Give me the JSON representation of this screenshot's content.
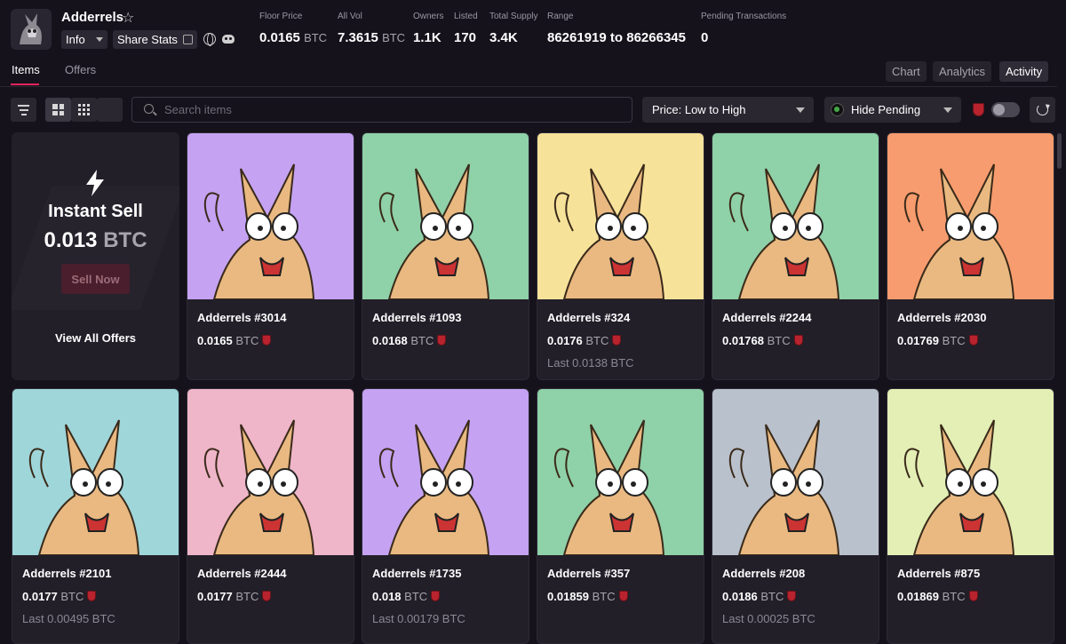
{
  "collection": {
    "name": "Adderrels",
    "info_label": "Info",
    "share_label": "Share Stats"
  },
  "stats": [
    {
      "label": "Floor Price",
      "value": "0.0165",
      "unit": "BTC"
    },
    {
      "label": "All Vol",
      "value": "7.3615",
      "unit": "BTC"
    },
    {
      "label": "Owners",
      "value": "1.1K",
      "unit": ""
    },
    {
      "label": "Listed",
      "value": "170",
      "unit": ""
    },
    {
      "label": "Total Supply",
      "value": "3.4K",
      "unit": ""
    },
    {
      "label": "Range",
      "value": "86261919 to 86266345",
      "unit": ""
    },
    {
      "label": "Pending Transactions",
      "value": "0",
      "unit": ""
    }
  ],
  "tabs": {
    "items": "Items",
    "offers": "Offers"
  },
  "view_tabs": [
    "Chart",
    "Analytics",
    "Activity"
  ],
  "toolbar": {
    "search_placeholder": "Search items",
    "sort_label": "Price: Low to High",
    "pending_label": "Hide Pending"
  },
  "instant_sell": {
    "title": "Instant Sell",
    "price": "0.013",
    "unit": "BTC",
    "button": "Sell Now",
    "view_all": "View All Offers"
  },
  "items": [
    {
      "name": "Adderrels #3014",
      "price": "0.0165",
      "unit": "BTC",
      "last": "",
      "bg": "#c5a2f2"
    },
    {
      "name": "Adderrels #1093",
      "price": "0.0168",
      "unit": "BTC",
      "last": "",
      "bg": "#8fd1a8"
    },
    {
      "name": "Adderrels #324",
      "price": "0.0176",
      "unit": "BTC",
      "last": "Last 0.0138 BTC",
      "bg": "#f7e29a"
    },
    {
      "name": "Adderrels #2244",
      "price": "0.01768",
      "unit": "BTC",
      "last": "",
      "bg": "#8fd1a8"
    },
    {
      "name": "Adderrels #2030",
      "price": "0.01769",
      "unit": "BTC",
      "last": "",
      "bg": "#f79c6e"
    },
    {
      "name": "Adderrels #2101",
      "price": "0.0177",
      "unit": "BTC",
      "last": "Last 0.00495 BTC",
      "bg": "#9fd6da"
    },
    {
      "name": "Adderrels #2444",
      "price": "0.0177",
      "unit": "BTC",
      "last": "",
      "bg": "#efb5c8"
    },
    {
      "name": "Adderrels #1735",
      "price": "0.018",
      "unit": "BTC",
      "last": "Last 0.00179 BTC",
      "bg": "#c5a2f2"
    },
    {
      "name": "Adderrels #357",
      "price": "0.01859",
      "unit": "BTC",
      "last": "",
      "bg": "#8fd1a8"
    },
    {
      "name": "Adderrels #208",
      "price": "0.0186",
      "unit": "BTC",
      "last": "Last 0.00025 BTC",
      "bg": "#b9c1cc"
    },
    {
      "name": "Adderrels #875",
      "price": "0.01869",
      "unit": "BTC",
      "last": "",
      "bg": "#e3efb5"
    }
  ],
  "colors": {
    "background": "#15121c",
    "card": "#221f29",
    "accent": "#e2245c",
    "shield": "#b8232e"
  },
  "icons": [
    "star-icon",
    "share-icon",
    "globe-icon",
    "discord-icon",
    "filter-icon",
    "grid-large-icon",
    "grid-small-icon",
    "list-icon",
    "search-icon",
    "chevron-down-icon",
    "shield-icon",
    "refresh-icon",
    "bolt-icon"
  ]
}
